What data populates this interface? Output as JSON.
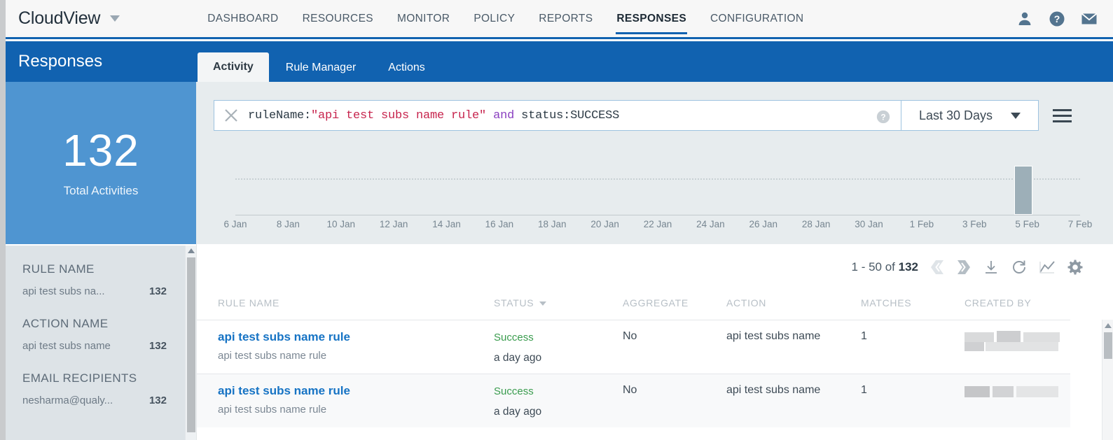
{
  "app": {
    "brand": "CloudView",
    "brand_caret": "chevron-down"
  },
  "topnav": {
    "items": [
      {
        "label": "DASHBOARD",
        "active": false
      },
      {
        "label": "RESOURCES",
        "active": false
      },
      {
        "label": "MONITOR",
        "active": false
      },
      {
        "label": "POLICY",
        "active": false
      },
      {
        "label": "REPORTS",
        "active": false
      },
      {
        "label": "RESPONSES",
        "active": true
      },
      {
        "label": "CONFIGURATION",
        "active": false
      }
    ],
    "icons": [
      "user-icon",
      "help-icon",
      "mail-icon"
    ],
    "accent": "#1162b0"
  },
  "left_panel": {
    "title": "Responses",
    "stat_value": "132",
    "stat_label": "Total Activities",
    "header_color": "#1162b0",
    "stat_color": "#4f95d1",
    "facets": [
      {
        "title": "RULE NAME",
        "name": "api test subs na...",
        "count": "132"
      },
      {
        "title": "ACTION NAME",
        "name": "api test subs name",
        "count": "132"
      },
      {
        "title": "EMAIL RECIPIENTS",
        "name": "nesharma@qualy...",
        "count": "132"
      }
    ]
  },
  "tabs": [
    {
      "label": "Activity",
      "active": true
    },
    {
      "label": "Rule Manager",
      "active": false
    },
    {
      "label": "Actions",
      "active": false
    }
  ],
  "search": {
    "clear_icon": "close-x-icon",
    "help_icon": "help-circle-icon",
    "query_tokens": [
      {
        "text": "ruleName:",
        "kind": "key"
      },
      {
        "text": "\"api test subs name rule\"",
        "kind": "string"
      },
      {
        "text": " and ",
        "kind": "operator"
      },
      {
        "text": "status:SUCCESS",
        "kind": "value"
      }
    ],
    "date_range": "Last 30 Days",
    "date_caret": "chevron-down-icon",
    "menu_icon": "hamburger-menu-icon"
  },
  "chart_data": {
    "type": "bar",
    "title": "",
    "xlabel": "",
    "ylabel": "",
    "grid": true,
    "legend": false,
    "categories": [
      "6 Jan",
      "8 Jan",
      "10 Jan",
      "12 Jan",
      "14 Jan",
      "16 Jan",
      "18 Jan",
      "20 Jan",
      "22 Jan",
      "24 Jan",
      "26 Jan",
      "28 Jan",
      "30 Jan",
      "1 Feb",
      "3 Feb",
      "5 Feb",
      "7 Feb"
    ],
    "tick_labels": [
      "6 Jan",
      "8 Jan",
      "10 Jan",
      "12 Jan",
      "14 Jan",
      "16 Jan",
      "18 Jan",
      "20 Jan",
      "22 Jan",
      "24 Jan",
      "26 Jan",
      "28 Jan",
      "30 Jan",
      "1 Feb",
      "3 Feb",
      "5 Feb",
      "7 Feb"
    ],
    "values": [
      0,
      0,
      0,
      0,
      0,
      0,
      0,
      0,
      0,
      0,
      0,
      0,
      0,
      0,
      0,
      132,
      0
    ],
    "ylim": [
      0,
      160
    ],
    "bar_color": "#9dafb8",
    "gridline_value": 100
  },
  "results": {
    "page_info_prefix": "1 - 50 of ",
    "page_info_total": "132",
    "prev_icon": "chevron-left-page-icon",
    "next_icon": "chevron-right-page-icon",
    "tool_icons": [
      "download-icon",
      "refresh-icon",
      "trend-chart-icon",
      "gear-icon"
    ],
    "columns": [
      {
        "label": "RULE NAME",
        "sortable": false
      },
      {
        "label": "STATUS",
        "sortable": true
      },
      {
        "label": "AGGREGATE",
        "sortable": false
      },
      {
        "label": "ACTION",
        "sortable": false
      },
      {
        "label": "MATCHES",
        "sortable": false
      },
      {
        "label": "CREATED BY",
        "sortable": false
      }
    ],
    "rows": [
      {
        "rule_name": "api test subs name rule",
        "rule_sub": "api test subs name rule",
        "status": "Success",
        "when": "a day ago",
        "aggregate": "No",
        "action": "api test subs name",
        "matches": "1",
        "created_by": "redacted"
      },
      {
        "rule_name": "api test subs name rule",
        "rule_sub": "api test subs name rule",
        "status": "Success",
        "when": "a day ago",
        "aggregate": "No",
        "action": "api test subs name",
        "matches": "1",
        "created_by": "redacted"
      }
    ],
    "status_color": "#3a9c4e",
    "link_color": "#1673c4"
  }
}
